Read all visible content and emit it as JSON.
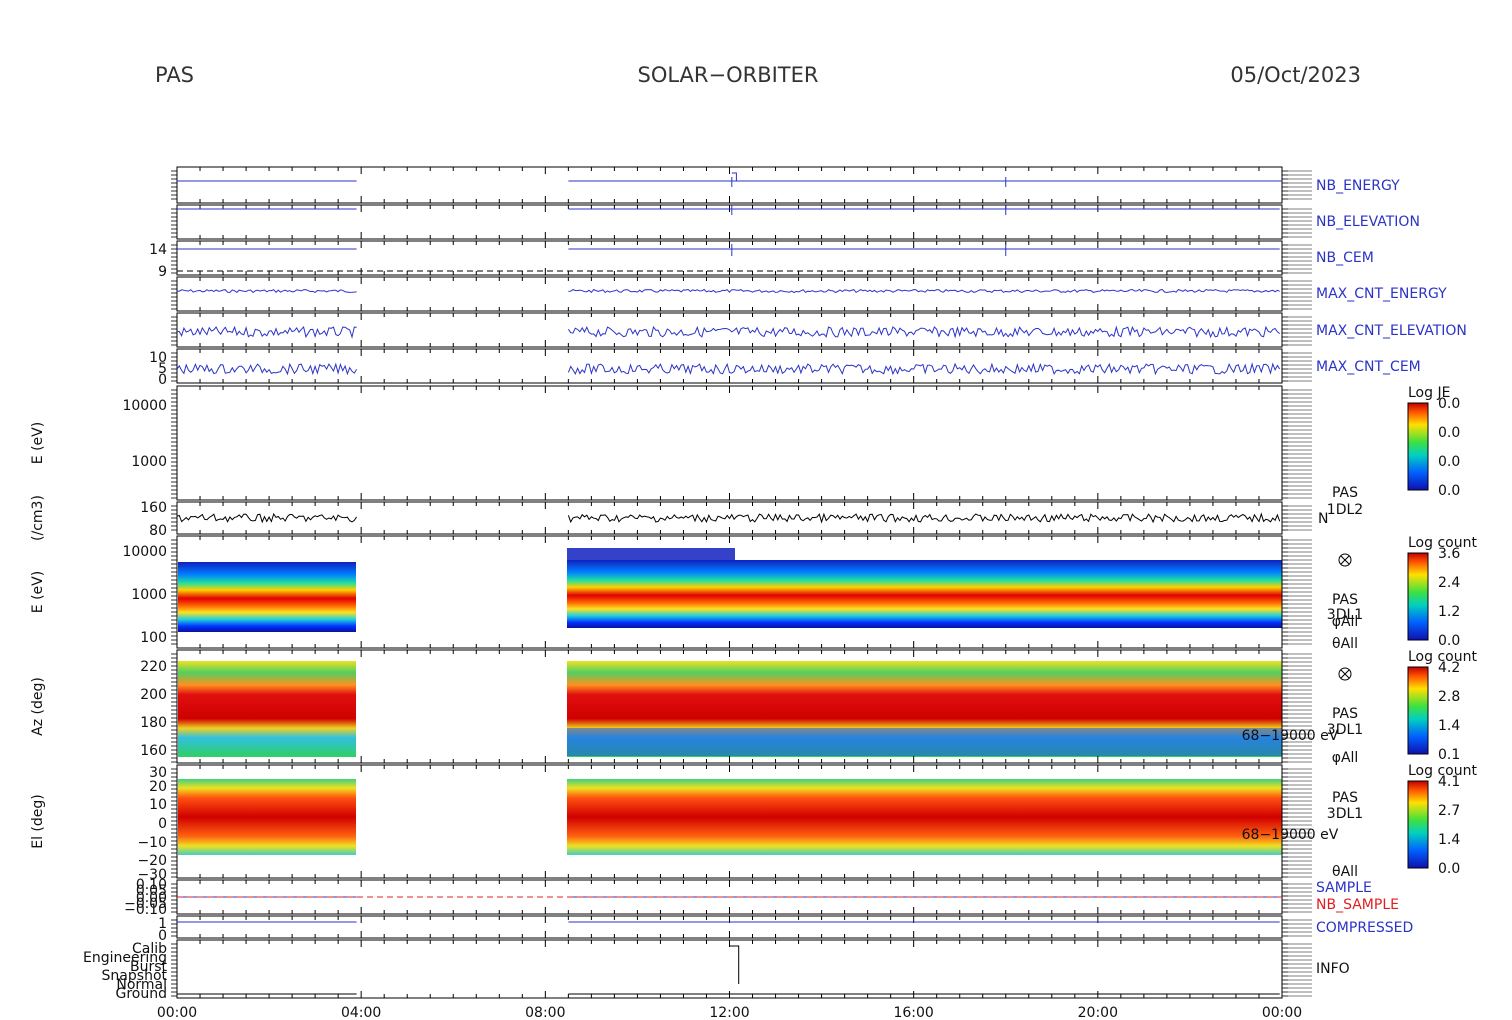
{
  "header": {
    "instrument": "PAS",
    "mission": "SOLAR−ORBITER",
    "date": "05/Oct/2023"
  },
  "colors": {
    "trace_blue": "#2b33c8",
    "red": "#e02020",
    "frame": "#000000"
  },
  "chart_data": {
    "type": "heatmap",
    "x_axis": {
      "ticks": [
        "00:00",
        "04:00",
        "08:00",
        "12:00",
        "16:00",
        "20:00",
        "00:00"
      ],
      "range_hours": [
        0,
        24
      ]
    },
    "data_gaps_hours": [
      [
        3.9,
        8.5
      ]
    ],
    "panels": [
      {
        "name": "NB_ENERGY",
        "type": "line",
        "color": "#2b33c8"
      },
      {
        "name": "NB_ELEVATION",
        "type": "line",
        "color": "#2b33c8"
      },
      {
        "name": "NB_CEM",
        "type": "line",
        "color": "#2b33c8",
        "yticks": [
          "14",
          "9"
        ]
      },
      {
        "name": "MAX_CNT_ENERGY",
        "type": "line",
        "color": "#2b33c8"
      },
      {
        "name": "MAX_CNT_ELEVATION",
        "type": "line",
        "color": "#2b33c8"
      },
      {
        "name": "MAX_CNT_CEM",
        "type": "line",
        "color": "#2b33c8",
        "yticks": [
          "10",
          "5",
          "0"
        ]
      },
      {
        "name": "E_1DL2",
        "type": "heatmap",
        "ylabel": "E (eV)",
        "yticks": [
          "10000",
          "1000"
        ],
        "colorbar": {
          "title": "Log JE",
          "ticks": [
            "0.0",
            "0.0",
            "0.0",
            "0.0"
          ]
        }
      },
      {
        "name": "N",
        "type": "line",
        "ylabel": "(/cm3)",
        "yticks": [
          "160",
          "80"
        ],
        "right_label": "N",
        "right_text": [
          "PAS",
          "1DL2"
        ]
      },
      {
        "name": "E_3DL1",
        "type": "heatmap",
        "ylabel": "E (eV)",
        "yticks": [
          "10000",
          "1000",
          "100"
        ],
        "right_text": [
          "PAS",
          "3DL1",
          "φAll",
          "θAll"
        ],
        "colorbar": {
          "title": "Log count",
          "ticks": [
            "3.6",
            "2.4",
            "1.2",
            "0.0"
          ]
        }
      },
      {
        "name": "Az_3DL1",
        "type": "heatmap",
        "ylabel": "Az (deg)",
        "yticks": [
          "220",
          "200",
          "180",
          "160"
        ],
        "right_text": [
          "PAS",
          "3DL1",
          "68−19000 eV",
          "φAll"
        ],
        "colorbar": {
          "title": "Log count",
          "ticks": [
            "4.2",
            "2.8",
            "1.4",
            "0.1"
          ]
        }
      },
      {
        "name": "El_3DL1",
        "type": "heatmap",
        "ylabel": "El (deg)",
        "yticks": [
          "30",
          "20",
          "10",
          "0",
          "−10",
          "−20",
          "−30"
        ],
        "right_text": [
          "PAS",
          "3DL1",
          "68−19000 eV",
          "θAll"
        ],
        "colorbar": {
          "title": "Log count",
          "ticks": [
            "4.1",
            "2.7",
            "1.4",
            "0.0"
          ]
        }
      },
      {
        "name": "SAMPLE",
        "type": "line",
        "color": "#2b33c8",
        "second_name": "NB_SAMPLE",
        "second_color": "#e02020",
        "yticks": [
          "0.10",
          "0.05",
          "0.00",
          "−0.05",
          "−0.10"
        ]
      },
      {
        "name": "COMPRESSED",
        "type": "line",
        "color": "#2b33c8",
        "yticks": [
          "1",
          "0"
        ]
      },
      {
        "name": "INFO",
        "type": "line",
        "yticks": [
          "Calib",
          "Engineering",
          "Burst",
          "Snapshot",
          "Normal",
          "Ground"
        ]
      }
    ]
  }
}
